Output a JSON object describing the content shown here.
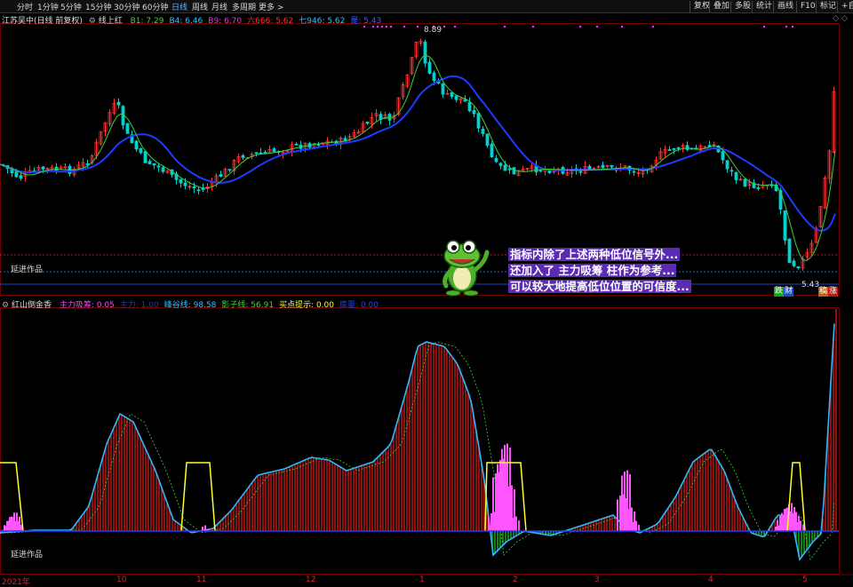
{
  "toolbar": {
    "periods": [
      "分时",
      "1分钟",
      "5分钟",
      "15分钟",
      "30分钟",
      "60分钟",
      "日线",
      "周线",
      "月线",
      "多周期",
      "更多 >"
    ],
    "active_period": "日线",
    "right_buttons": [
      "复权",
      "叠加",
      "多股",
      "统计",
      "画线",
      "F10",
      "标记",
      "+自"
    ]
  },
  "upper": {
    "title": "江苏吴中(日线 前复权)",
    "indicator": "线上红",
    "values": [
      {
        "label": "B1: 7.29",
        "color": "#3cd23c"
      },
      {
        "label": "B4: 6.46",
        "color": "#30c0ff"
      },
      {
        "label": "B9: 6.70",
        "color": "#d040d0"
      },
      {
        "label": "六666: 5.62",
        "color": "#ff3030"
      },
      {
        "label": "七946: 5.62",
        "color": "#30c0ff"
      },
      {
        "label": "是: 5.43",
        "color": "#4060ff"
      }
    ],
    "high_label": "8.89",
    "low_label": "5.43",
    "watermark": "延进作品",
    "bottom_tags": [
      {
        "text": "跌",
        "bg": "#18a018",
        "color": "#fff"
      },
      {
        "text": "财",
        "bg": "#1a4fc0",
        "color": "#fff"
      },
      {
        "text": "稿",
        "bg": "#c06010",
        "color": "#fff"
      },
      {
        "text": "涨",
        "bg": "#c01818",
        "color": "#fff"
      }
    ]
  },
  "lower": {
    "title": "红山倒金香",
    "values": [
      {
        "label": "主力吸筹: 0.05",
        "color": "#ff40ff"
      },
      {
        "label": "主力: 1.00",
        "color": "#2a3a8a"
      },
      {
        "label": "峰谷线: 98.58",
        "color": "#30c0ff"
      },
      {
        "label": "影子线: 56.91",
        "color": "#3cd23c"
      },
      {
        "label": "买点提示: 0.00",
        "color": "#ffff30"
      },
      {
        "label": "底量: 0.00",
        "color": "#2040ff"
      }
    ],
    "watermark": "延进作品"
  },
  "annotation": {
    "lines": [
      "指标内除了上述两种低位信号外...",
      "还加入了 主力吸筹 柱作为参考...",
      "可以较大地提高低位位置的可信度..."
    ]
  },
  "time_axis": [
    "2021年",
    "10",
    "11",
    "12",
    "1",
    "2",
    "3",
    "4",
    "5"
  ],
  "colors": {
    "up": "#ff3232",
    "down": "#00d2d2",
    "ma_blue": "#1f3bff",
    "ma_green": "#3cd23c",
    "peak": "#30b8ff",
    "buy": "#ffff30",
    "absorb": "#ff55ff"
  }
}
